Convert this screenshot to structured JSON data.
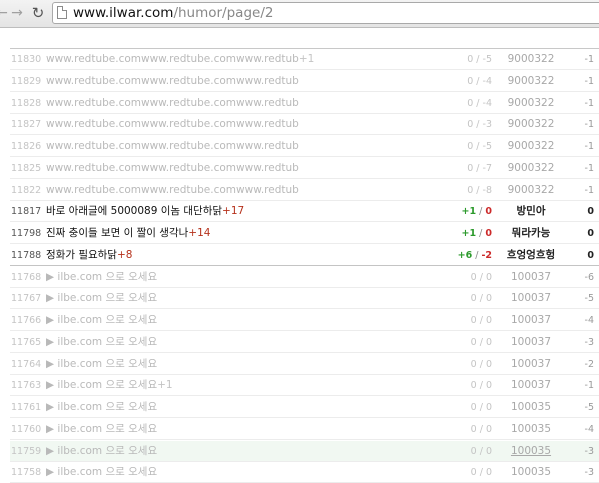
{
  "browser": {
    "url_host": "www.ilwar.com",
    "url_path": "/humor/page/2",
    "back_icon": "arrow-left",
    "forward_icon": "arrow-right",
    "reload_icon": "reload"
  },
  "rows": [
    {
      "num": "11830",
      "title": "www.redtube.comwww.redtube.comwww.redtub",
      "count": "+1",
      "up": "0",
      "down": "-5",
      "author": "9000322",
      "score": "-1",
      "style": "dim"
    },
    {
      "num": "11829",
      "title": "www.redtube.comwww.redtube.comwww.redtub",
      "count": "",
      "up": "0",
      "down": "-4",
      "author": "9000322",
      "score": "-1",
      "style": "dim"
    },
    {
      "num": "11828",
      "title": "www.redtube.comwww.redtube.comwww.redtub",
      "count": "",
      "up": "0",
      "down": "-4",
      "author": "9000322",
      "score": "-1",
      "style": "dim"
    },
    {
      "num": "11827",
      "title": "www.redtube.comwww.redtube.comwww.redtub",
      "count": "",
      "up": "0",
      "down": "-3",
      "author": "9000322",
      "score": "-1",
      "style": "dim"
    },
    {
      "num": "11826",
      "title": "www.redtube.comwww.redtube.comwww.redtub",
      "count": "",
      "up": "0",
      "down": "-5",
      "author": "9000322",
      "score": "-1",
      "style": "dim"
    },
    {
      "num": "11825",
      "title": "www.redtube.comwww.redtube.comwww.redtub",
      "count": "",
      "up": "0",
      "down": "-7",
      "author": "9000322",
      "score": "-1",
      "style": "dim"
    },
    {
      "num": "11822",
      "title": "www.redtube.comwww.redtube.comwww.redtub",
      "count": "",
      "up": "0",
      "down": "-8",
      "author": "9000322",
      "score": "-1",
      "style": "dim"
    },
    {
      "num": "11817",
      "title": "바로 아래글에 5000089 이놈 대단하닭",
      "count": "+17",
      "up": "+1",
      "down": "0",
      "author": "방민아",
      "score": "0",
      "style": "bold"
    },
    {
      "num": "11798",
      "title": "진짜 충이들 보면 이 짤이 생각나",
      "count": "+14",
      "up": "+1",
      "down": "0",
      "author": "뭐라카능",
      "score": "0",
      "style": "bold"
    },
    {
      "num": "11788",
      "title": "정화가 필요하닭",
      "count": "+8",
      "up": "+6",
      "down": "-2",
      "author": "흐엉엉흐헝",
      "score": "0",
      "style": "bold"
    },
    {
      "num": "11768",
      "title": "▶ ilbe.com 으로 오세요",
      "count": "",
      "up": "0",
      "down": "0",
      "author": "100037",
      "score": "-6",
      "style": "dim"
    },
    {
      "num": "11767",
      "title": "▶ ilbe.com 으로 오세요",
      "count": "",
      "up": "0",
      "down": "0",
      "author": "100037",
      "score": "-5",
      "style": "dim"
    },
    {
      "num": "11766",
      "title": "▶ ilbe.com 으로 오세요",
      "count": "",
      "up": "0",
      "down": "0",
      "author": "100037",
      "score": "-4",
      "style": "dim"
    },
    {
      "num": "11765",
      "title": "▶ ilbe.com 으로 오세요",
      "count": "",
      "up": "0",
      "down": "0",
      "author": "100037",
      "score": "-3",
      "style": "dim"
    },
    {
      "num": "11764",
      "title": "▶ ilbe.com 으로 오세요",
      "count": "",
      "up": "0",
      "down": "0",
      "author": "100037",
      "score": "-2",
      "style": "dim"
    },
    {
      "num": "11763",
      "title": "▶ ilbe.com 으로 오세요",
      "count": "+1",
      "up": "0",
      "down": "0",
      "author": "100037",
      "score": "-1",
      "style": "dim"
    },
    {
      "num": "11761",
      "title": "▶ ilbe.com 으로 오세요",
      "count": "",
      "up": "0",
      "down": "0",
      "author": "100035",
      "score": "-5",
      "style": "dim"
    },
    {
      "num": "11760",
      "title": "▶ ilbe.com 으로 오세요",
      "count": "",
      "up": "0",
      "down": "0",
      "author": "100035",
      "score": "-4",
      "style": "dim"
    },
    {
      "num": "11759",
      "title": "▶ ilbe.com 으로 오세요",
      "count": "",
      "up": "0",
      "down": "0",
      "author": "100035",
      "score": "-3",
      "style": "dim highlight"
    },
    {
      "num": "11758",
      "title": "▶ ilbe.com 으로 오세요",
      "count": "",
      "up": "0",
      "down": "0",
      "author": "100035",
      "score": "-3",
      "style": "dim"
    }
  ]
}
